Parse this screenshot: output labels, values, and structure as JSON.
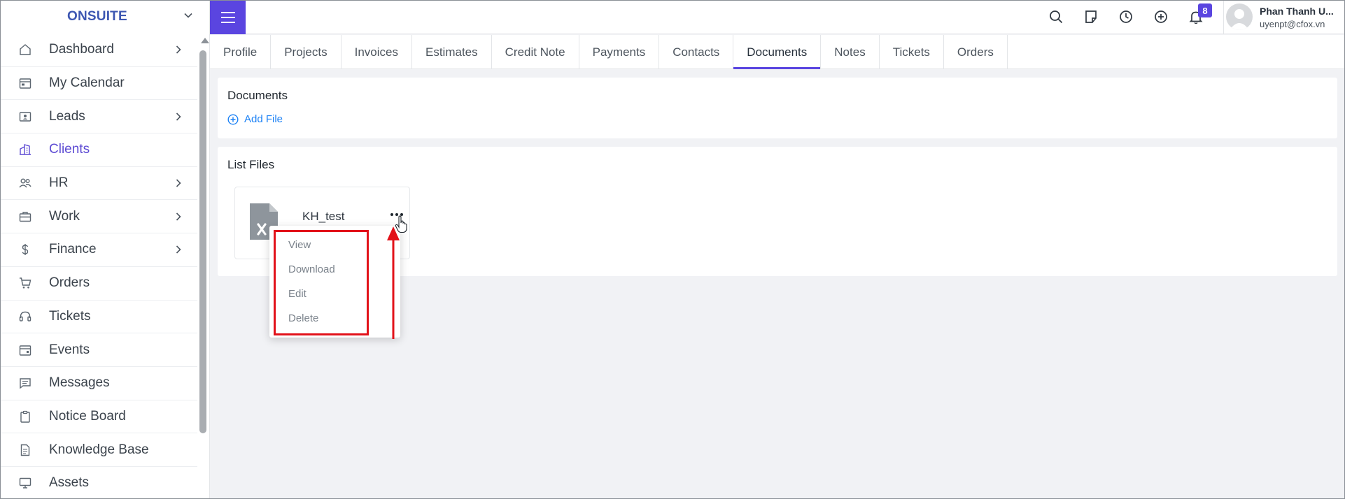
{
  "brand": {
    "name": "ONSUITE"
  },
  "sidebar": {
    "items": [
      {
        "label": "Dashboard",
        "icon": "home-icon",
        "has_arrow": true
      },
      {
        "label": "My Calendar",
        "icon": "calendar-icon",
        "has_arrow": false
      },
      {
        "label": "Leads",
        "icon": "id-card-icon",
        "has_arrow": true
      },
      {
        "label": "Clients",
        "icon": "building-icon",
        "has_arrow": false,
        "active": true
      },
      {
        "label": "HR",
        "icon": "people-icon",
        "has_arrow": true
      },
      {
        "label": "Work",
        "icon": "briefcase-icon",
        "has_arrow": true
      },
      {
        "label": "Finance",
        "icon": "dollar-icon",
        "has_arrow": true
      },
      {
        "label": "Orders",
        "icon": "cart-icon",
        "has_arrow": false
      },
      {
        "label": "Tickets",
        "icon": "headset-icon",
        "has_arrow": false
      },
      {
        "label": "Events",
        "icon": "calendar-event-icon",
        "has_arrow": false
      },
      {
        "label": "Messages",
        "icon": "message-icon",
        "has_arrow": false
      },
      {
        "label": "Notice Board",
        "icon": "clipboard-icon",
        "has_arrow": false
      },
      {
        "label": "Knowledge Base",
        "icon": "document-icon",
        "has_arrow": false
      },
      {
        "label": "Assets",
        "icon": "monitor-icon",
        "has_arrow": false
      }
    ]
  },
  "topbar": {
    "notification_count": "8",
    "user": {
      "name": "Phan Thanh U...",
      "email": "uyenpt@cfox.vn"
    }
  },
  "tabs": [
    {
      "label": "Profile"
    },
    {
      "label": "Projects"
    },
    {
      "label": "Invoices"
    },
    {
      "label": "Estimates"
    },
    {
      "label": "Credit Note"
    },
    {
      "label": "Payments"
    },
    {
      "label": "Contacts"
    },
    {
      "label": "Documents",
      "active": true
    },
    {
      "label": "Notes"
    },
    {
      "label": "Tickets"
    },
    {
      "label": "Orders"
    }
  ],
  "documents": {
    "title": "Documents",
    "add_file_label": "Add File"
  },
  "list_files": {
    "title": "List Files",
    "file": {
      "name": "KH_test",
      "icon": "excel-file-icon"
    },
    "menu": [
      "View",
      "Download",
      "Edit",
      "Delete"
    ]
  },
  "colors": {
    "accent": "#5a45e0",
    "brand": "#3d57b2",
    "link": "#1d82f5",
    "annotation": "#e2121a"
  }
}
